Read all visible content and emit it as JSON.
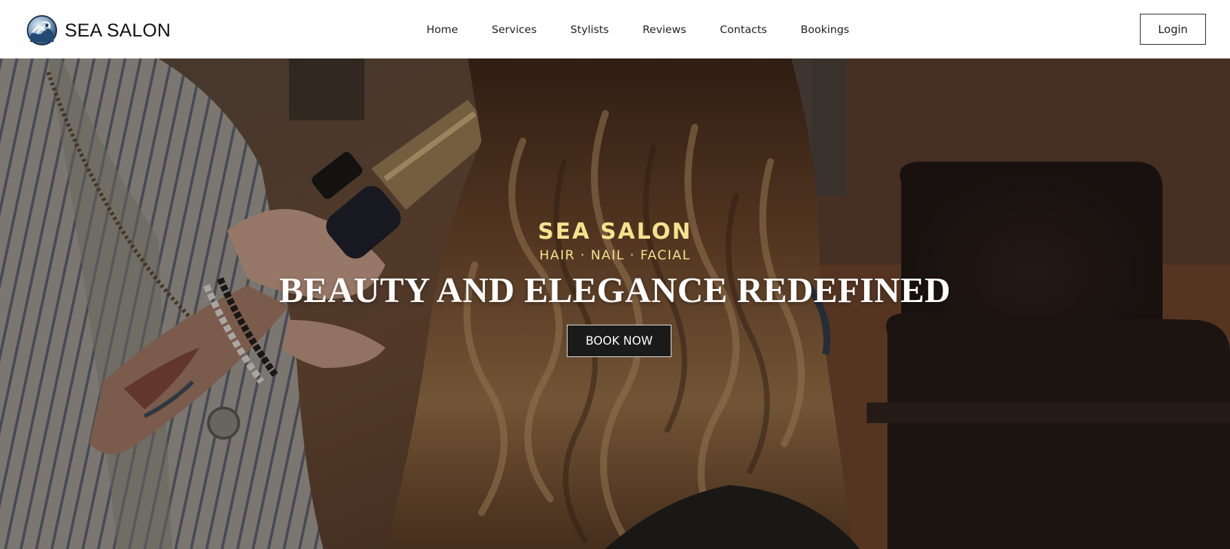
{
  "header": {
    "brand_name": "SEA SALON",
    "logo_icon": "sea-wave-logo-icon",
    "nav": [
      {
        "label": "Home"
      },
      {
        "label": "Services"
      },
      {
        "label": "Stylists"
      },
      {
        "label": "Reviews"
      },
      {
        "label": "Contacts"
      },
      {
        "label": "Bookings"
      }
    ],
    "login_label": "Login"
  },
  "hero": {
    "brand": "SEA SALON",
    "tagline": "HAIR · NAIL · FACIAL",
    "title": "BEAUTY AND ELEGANCE REDEFINED",
    "cta_label": "BOOK NOW",
    "background_image": "salon-stylist-curling-hair-photo"
  },
  "colors": {
    "accent_gold": "#f4e38f",
    "header_bg": "#ffffff",
    "button_dark": "#1a1a1a",
    "text_dark": "#222222"
  }
}
